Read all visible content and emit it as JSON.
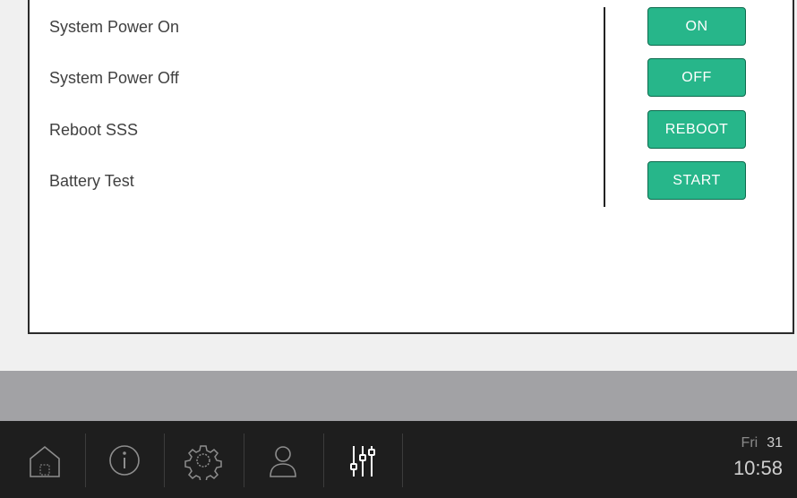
{
  "rows": [
    {
      "label": "System Power On",
      "button": "ON"
    },
    {
      "label": "System Power Off",
      "button": "OFF"
    },
    {
      "label": "Reboot SSS",
      "button": "REBOOT"
    },
    {
      "label": "Battery Test",
      "button": "START"
    }
  ],
  "taskbar": {
    "icons": [
      "home-icon",
      "info-icon",
      "gear-icon",
      "user-icon",
      "sliders-icon"
    ],
    "clock": {
      "day": "Fri",
      "date": "31",
      "time": "10:58"
    }
  },
  "colors": {
    "button_green": "#27b68a",
    "taskbar_bg": "#1e1e1e",
    "band_gray": "#a2a2a5"
  }
}
